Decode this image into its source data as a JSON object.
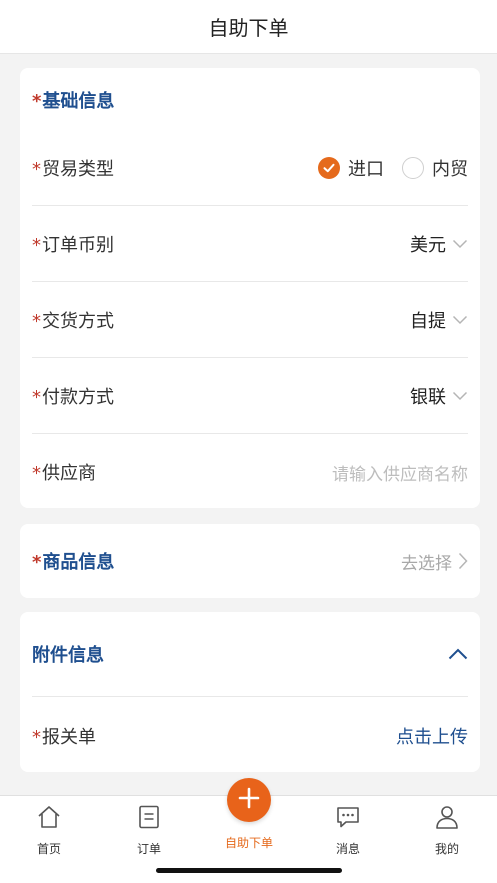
{
  "header": {
    "title": "自助下单"
  },
  "required_mark": "*",
  "basic": {
    "title": "基础信息",
    "trade_type": {
      "label": "贸易类型",
      "options": [
        "进口",
        "内贸"
      ],
      "selected": "进口"
    },
    "currency": {
      "label": "订单币别",
      "value": "美元"
    },
    "delivery": {
      "label": "交货方式",
      "value": "自提"
    },
    "payment": {
      "label": "付款方式",
      "value": "银联"
    },
    "supplier": {
      "label": "供应商",
      "placeholder": "请输入供应商名称"
    }
  },
  "goods": {
    "title": "商品信息",
    "action": "去选择"
  },
  "attachments": {
    "title": "附件信息",
    "customs": {
      "label": "报关单",
      "action": "点击上传"
    }
  },
  "tabbar": {
    "items": [
      {
        "label": "首页",
        "icon": "home-icon"
      },
      {
        "label": "订单",
        "icon": "order-icon"
      },
      {
        "label": "自助下单",
        "icon": "plus-icon"
      },
      {
        "label": "消息",
        "icon": "message-icon"
      },
      {
        "label": "我的",
        "icon": "user-icon"
      }
    ]
  },
  "colors": {
    "accent": "#e56a1c",
    "title_blue": "#1f4f8f",
    "required": "#c0392b"
  }
}
